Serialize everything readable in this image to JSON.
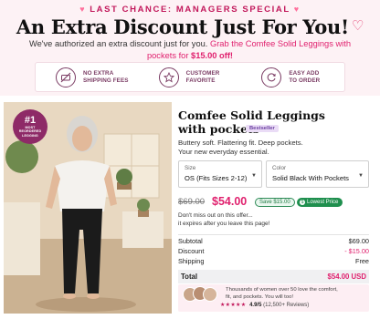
{
  "banner": {
    "eyebrow": "LAST CHANCE: MANAGERS SPECIAL",
    "headline": "An Extra Discount Just For You!",
    "sub_normal": "We've authorized an extra discount just for you.",
    "sub_pink": "Grab the Comfee Solid Leggings with pockets for",
    "sub_price": "$15.00 off!"
  },
  "features": [
    {
      "icon": "no-shipping-fee-icon",
      "line1": "NO EXTRA",
      "line2": "SHIPPING FEES"
    },
    {
      "icon": "star-icon",
      "line1": "CUSTOMER",
      "line2": "FAVORITE"
    },
    {
      "icon": "refresh-icon",
      "line1": "EASY ADD",
      "line2": "TO ORDER"
    }
  ],
  "photo_badge": {
    "number": "#1",
    "line1": "MOST",
    "line2": "REORDERED",
    "line3": "LEGGING"
  },
  "product": {
    "title_line1": "Comfee Solid Leggings",
    "title_line2": "with pockets",
    "badge": "Bestseller",
    "desc_line1": "Buttery soft. Flattering fit. Deep pockets.",
    "desc_line2": "Your new everyday essential."
  },
  "size_select": {
    "label": "Size",
    "value": "OS (Fits Sizes 2-12)"
  },
  "color_select": {
    "label": "Color",
    "value": "Solid Black With Pockets"
  },
  "pricing": {
    "old_price": "$69.00",
    "new_price": "$54.00",
    "save_chip": "Save $15.00",
    "lowest_chip": "Lowest Price"
  },
  "urgency": {
    "line1": "Don't miss out on this offer...",
    "line2": "it expires after you leave this page!"
  },
  "summary": {
    "subtotal_label": "Subtotal",
    "subtotal_value": "$69.00",
    "discount_label": "Discount",
    "discount_value": "- $15.00",
    "shipping_label": "Shipping",
    "shipping_value": "Free",
    "total_label": "Total",
    "total_value": "$54.00 USD"
  },
  "testimonial": {
    "text_line1": "Thousands of women over 50 love the comfort,",
    "text_line2": "fit, and pockets. You will too!",
    "stars": "★★★★★",
    "rating": "4.9/5",
    "reviews": "(12,500+ Reviews)"
  },
  "colors": {
    "accent_pink": "#e0216e",
    "badge_purple": "#8e2a67",
    "success_green": "#1f8f4e"
  }
}
